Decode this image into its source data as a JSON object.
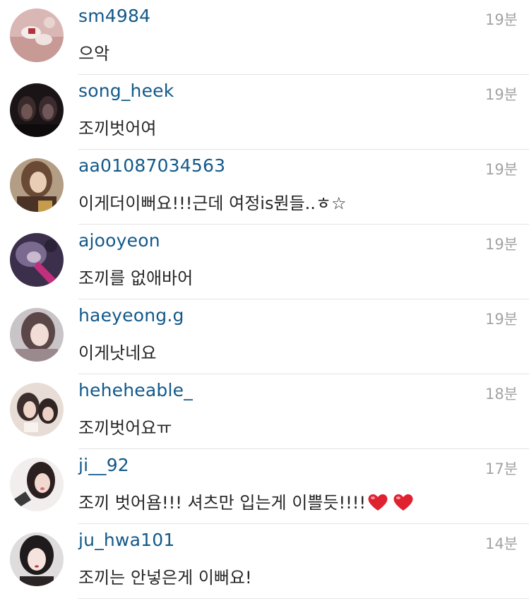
{
  "comments": [
    {
      "username": "sm4984",
      "time": "19분",
      "text": "으악"
    },
    {
      "username": "song_heek",
      "time": "19분",
      "text": "조끼벗어여"
    },
    {
      "username": "aa01087034563",
      "time": "19분",
      "text": "이게더이뻐요!!!근데 여정is뭔들..ㅎ☆"
    },
    {
      "username": "ajooyeon",
      "time": "19분",
      "text": "조끼를 없애바어"
    },
    {
      "username": "haeyeong.g",
      "time": "19분",
      "text": "이게낫네요"
    },
    {
      "username": "heheheable_",
      "time": "18분",
      "text": "조끼벗어요ㅠ"
    },
    {
      "username": "ji__92",
      "time": "17분",
      "text": "조끼 벗어욤!!! 셔츠만 입는게 이쁠듯!!!!"
    },
    {
      "username": "ju_hwa101",
      "time": "14분",
      "text": "조끼는 안넣은게 이뻐요!"
    }
  ],
  "icons": {
    "heart": "heart-icon",
    "heart_color": "#e0212f"
  }
}
